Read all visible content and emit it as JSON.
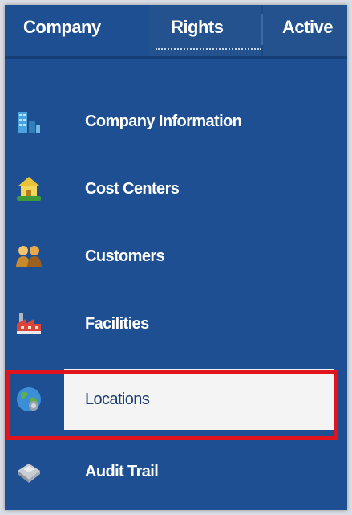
{
  "tabs": [
    {
      "label": "Company",
      "active": true
    },
    {
      "label": "Rights",
      "active": false
    },
    {
      "label": "Active",
      "active": false
    }
  ],
  "menu": {
    "items": [
      {
        "label": "Company Information",
        "icon": "building-icon"
      },
      {
        "label": "Cost Centers",
        "icon": "cost-center-house-icon"
      },
      {
        "label": "Customers",
        "icon": "customers-people-icon"
      },
      {
        "label": "Facilities",
        "icon": "facility-factory-icon"
      },
      {
        "label": "Locations",
        "icon": "globe-icon",
        "selected": true
      },
      {
        "label": "Audit Trail",
        "icon": "audit-trail-printer-icon"
      }
    ]
  },
  "colors": {
    "panel": "#1e4f92",
    "selected_bg": "#f4f4f4",
    "highlight": "#e0141c"
  }
}
